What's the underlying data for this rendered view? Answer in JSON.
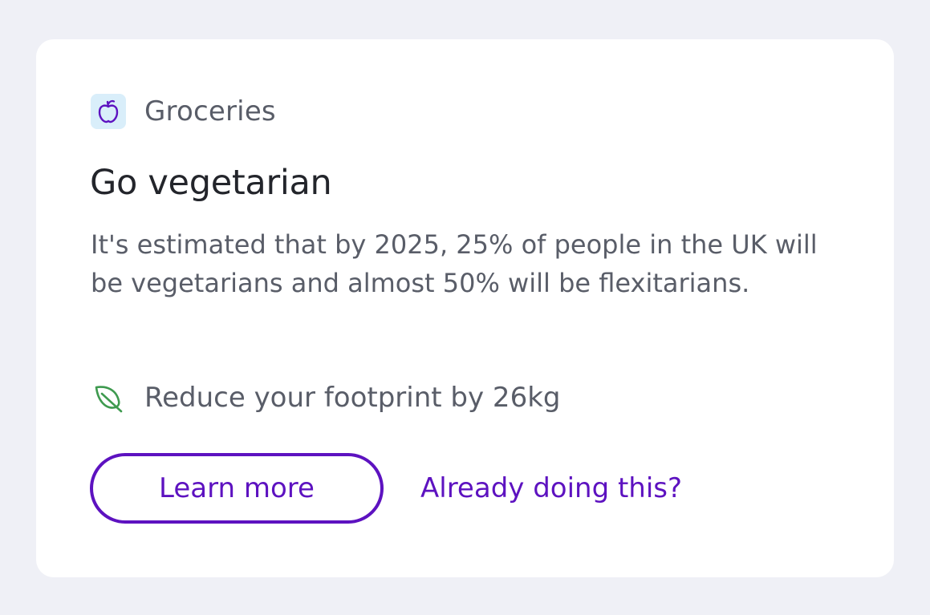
{
  "card": {
    "category": {
      "icon": "apple-icon",
      "label": "Groceries"
    },
    "title": "Go vegetarian",
    "description": "It's estimated that by 2025, 25% of people in the UK will be vegetarians and almost 50% will be flexitarians.",
    "impact": {
      "icon": "leaf-icon",
      "label": "Reduce your footprint by 26kg"
    },
    "actions": {
      "primary_label": "Learn more",
      "secondary_label": "Already doing this?"
    }
  },
  "colors": {
    "background": "#eff0f6",
    "card": "#ffffff",
    "accent": "#5d12c0",
    "category_icon_bg": "#d9eefa",
    "leaf_icon": "#3e9a4f",
    "title_text": "#23252b",
    "body_text": "#595d68"
  }
}
